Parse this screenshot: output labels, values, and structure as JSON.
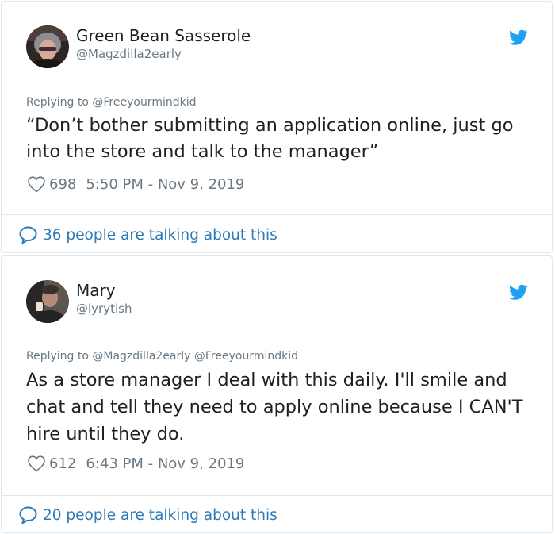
{
  "tweets": [
    {
      "name": "Green Bean Sasserole",
      "handle": "@Magzdilla2early",
      "replying": "Replying to @Freeyourmindkid",
      "text": "“Don’t bother submitting an application online, just go into the store and talk to the manager”",
      "likes": "698",
      "timestamp": "5:50 PM - Nov 9, 2019",
      "talking": "36 people are talking about this"
    },
    {
      "name": "Mary",
      "handle": "@lyrytish",
      "replying": "Replying to @Magzdilla2early @Freeyourmindkid",
      "text": "As a store manager I deal with this daily. I'll smile and chat and tell they need to apply online because I CAN'T hire until they do.",
      "likes": "612",
      "timestamp": "6:43 PM - Nov 9, 2019",
      "talking": "20 people are talking about this"
    }
  ],
  "icons": {
    "brand": "twitter-bird-icon",
    "like": "heart-icon",
    "reply": "speech-bubble-icon"
  },
  "colors": {
    "brand_blue": "#1da1f2",
    "link_blue": "#2b7bb9",
    "muted": "#697882",
    "text": "#1c2022",
    "border": "#e1e8ed"
  }
}
